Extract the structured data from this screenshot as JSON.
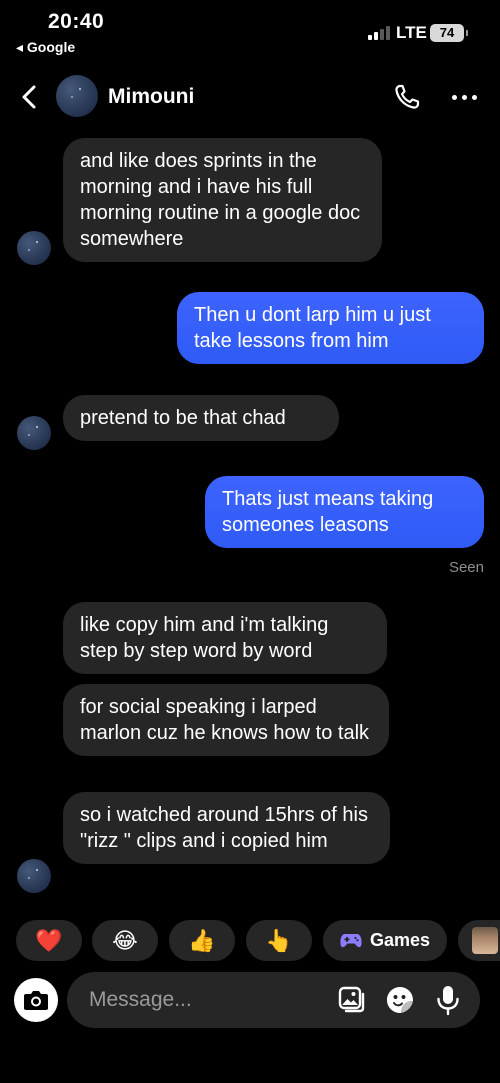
{
  "status_bar": {
    "time": "20:40",
    "back_app": "◂ Google",
    "network": "LTE",
    "battery": "74"
  },
  "header": {
    "contact_name": "Mimouni",
    "back_icon": "chevron-left-icon",
    "call_icon": "phone-icon",
    "more_icon": "more-horizontal-icon"
  },
  "messages": [
    {
      "side": "in",
      "text": "and like does sprints in the morning and i have his full morning routine in a google doc somewhere"
    },
    {
      "side": "out",
      "text": "Then u dont larp him u just take lessons from him"
    },
    {
      "side": "in",
      "text": "pretend to be that chad"
    },
    {
      "side": "out",
      "text": "Thats just means taking someones leasons"
    },
    {
      "side": "in",
      "text": "like copy him and i'm talking step by step word by word"
    },
    {
      "side": "in",
      "text": "for social speaking i larped marlon cuz he knows how to talk"
    },
    {
      "side": "in",
      "text": "so i watched around 15hrs of his \"rizz \" clips and i copied him"
    }
  ],
  "seen_label": "Seen",
  "quick_reactions": {
    "heart": "❤️",
    "joy": "😂",
    "thumbs_up": "👍",
    "point": "👆",
    "games_label": "Games"
  },
  "composer": {
    "placeholder": "Message..."
  },
  "colors": {
    "background": "#000000",
    "incoming_bubble": "#262626",
    "outgoing_bubble": "#3e63ff",
    "secondary_text": "#8e8e8e"
  }
}
